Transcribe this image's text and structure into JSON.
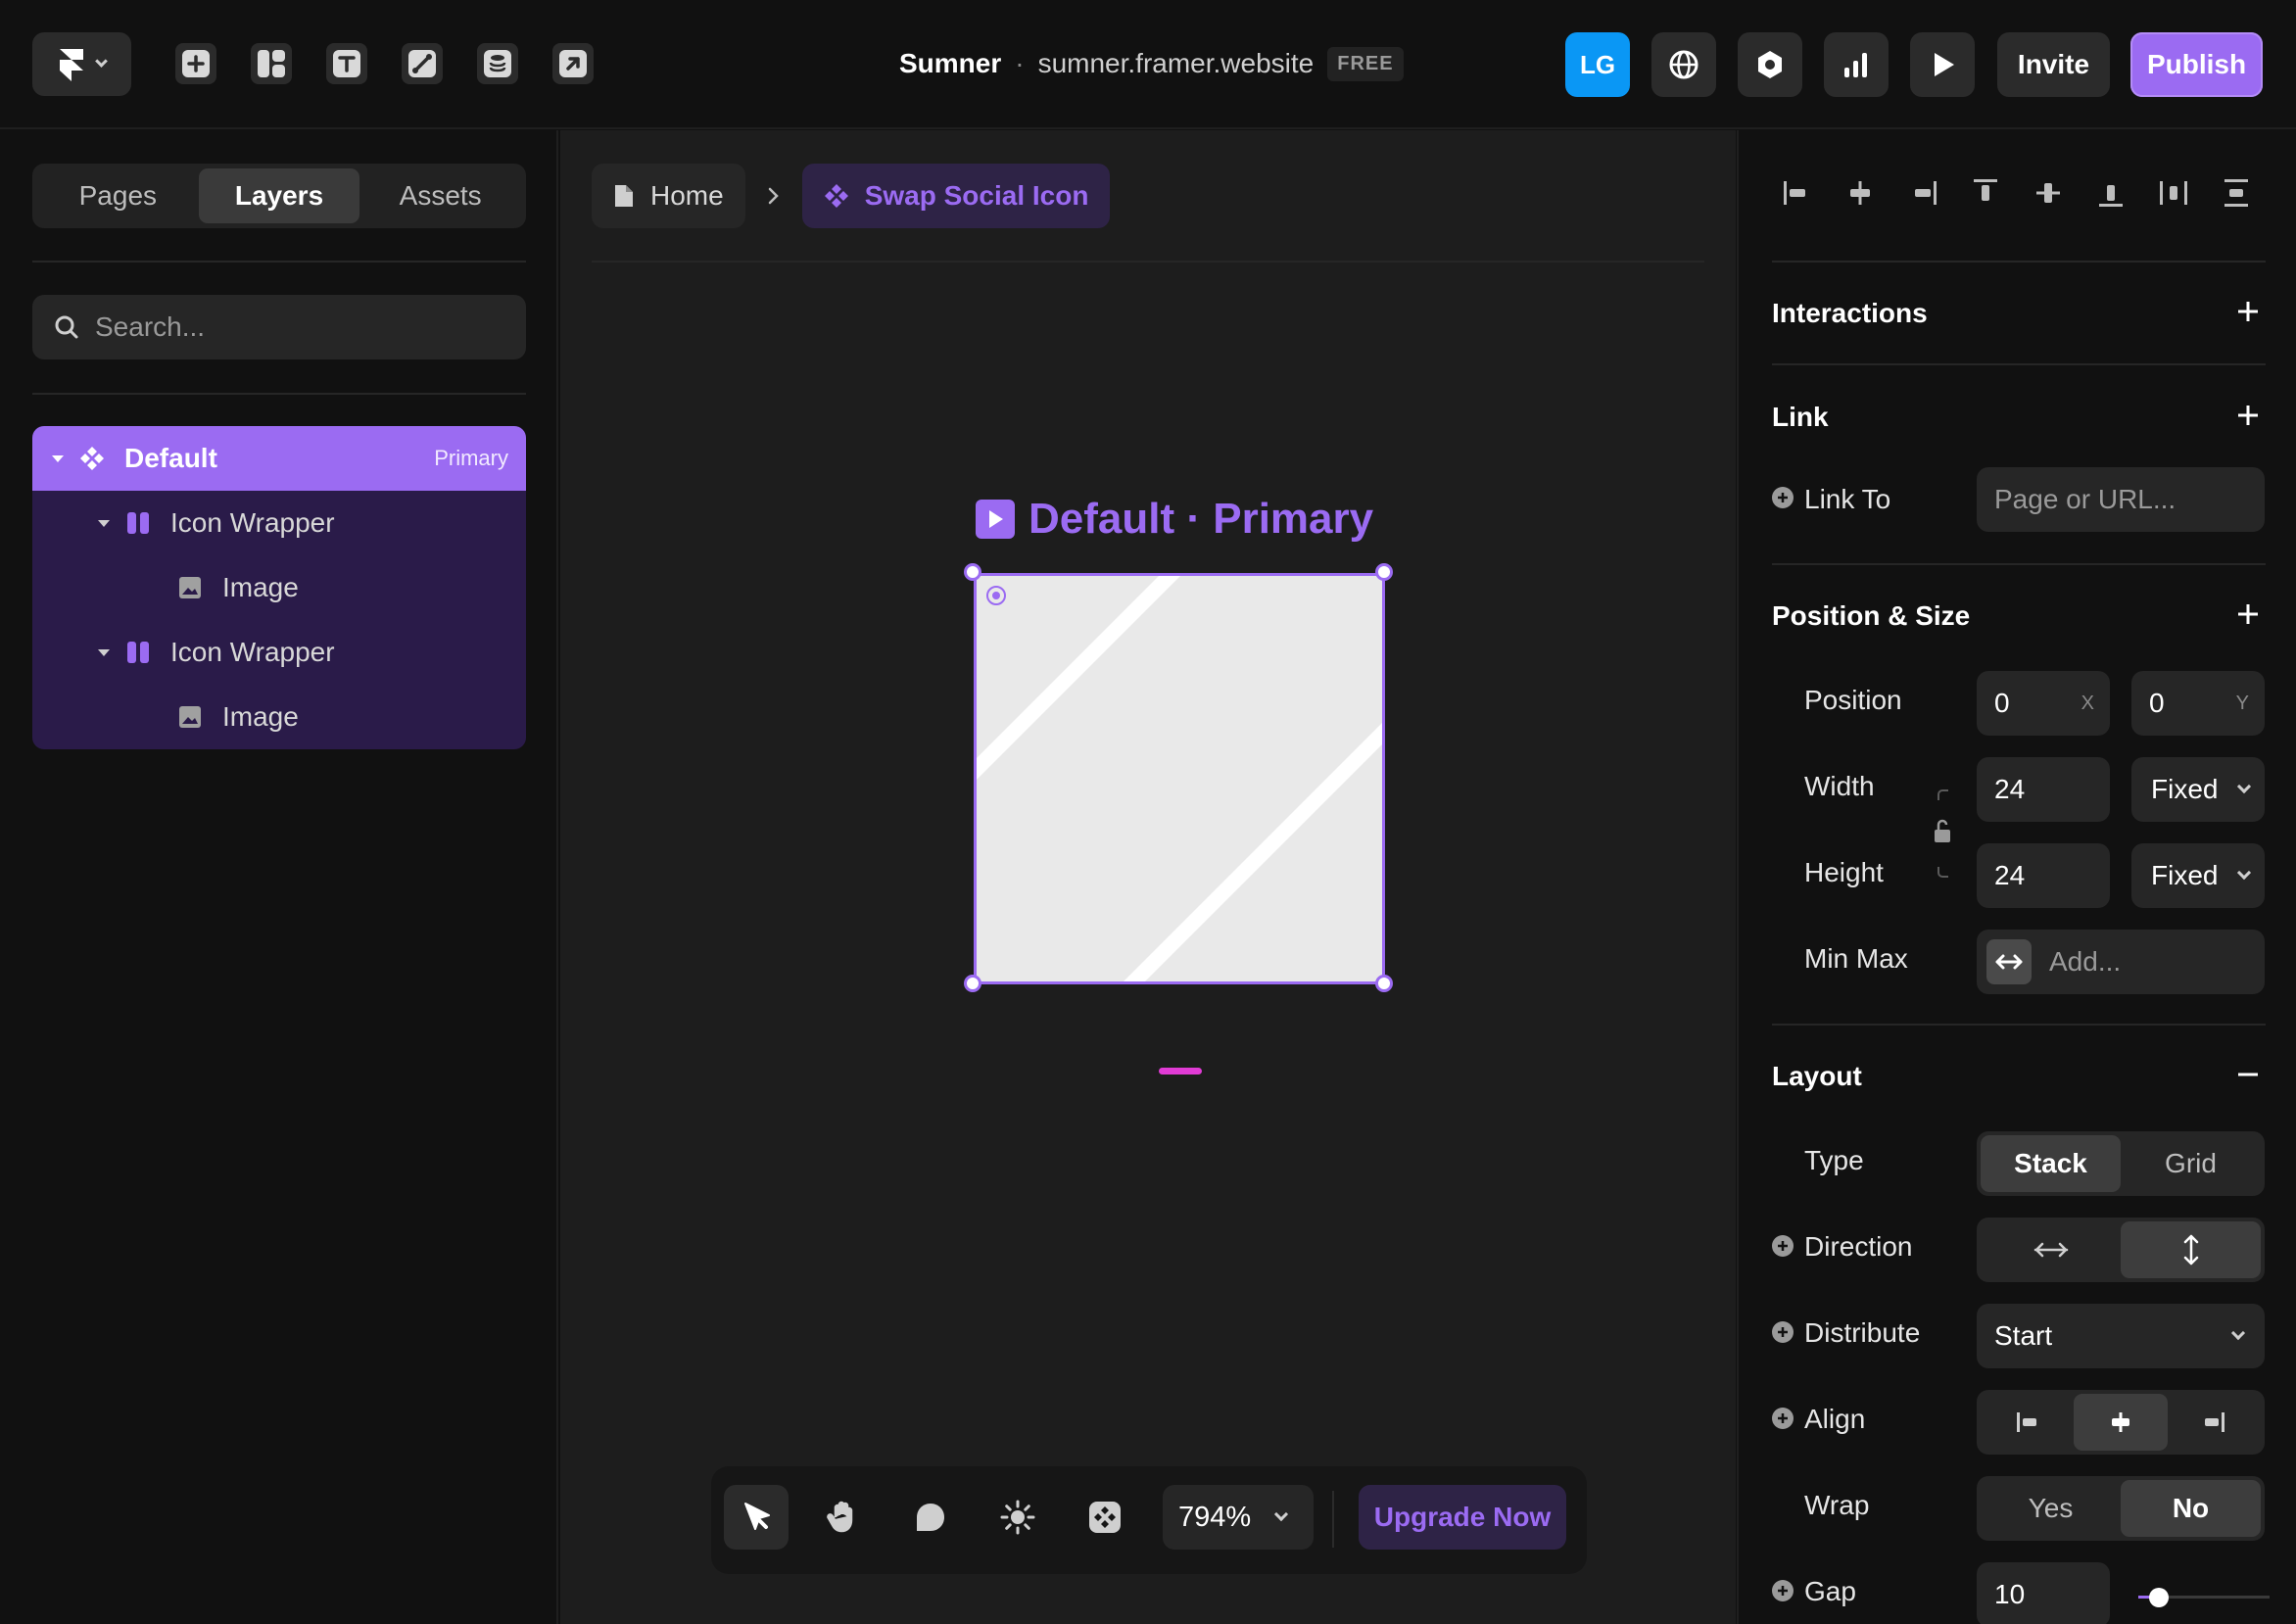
{
  "topbar": {
    "site_name": "Sumner",
    "separator": "·",
    "site_domain": "sumner.framer.website",
    "plan_badge": "FREE",
    "avatar_initials": "LG",
    "invite_label": "Invite",
    "publish_label": "Publish",
    "tools": [
      "insert-icon",
      "layout-icon",
      "text-icon",
      "vector-pen-icon",
      "cms-database-icon",
      "external-link-icon"
    ],
    "right_icons": [
      "globe-icon",
      "settings-icon",
      "analytics-icon",
      "preview-play-icon"
    ]
  },
  "left_panel": {
    "tabs": [
      {
        "label": "Pages",
        "active": false
      },
      {
        "label": "Layers",
        "active": true
      },
      {
        "label": "Assets",
        "active": false
      }
    ],
    "search_placeholder": "Search...",
    "layers": [
      {
        "label": "Default",
        "badge": "Primary",
        "depth": 0,
        "type": "component",
        "selected": true,
        "expanded": true
      },
      {
        "label": "Icon Wrapper",
        "depth": 1,
        "type": "stack",
        "expanded": true
      },
      {
        "label": "Image",
        "depth": 2,
        "type": "image"
      },
      {
        "label": "Icon Wrapper",
        "depth": 1,
        "type": "stack",
        "expanded": true
      },
      {
        "label": "Image",
        "depth": 2,
        "type": "image"
      }
    ]
  },
  "canvas": {
    "breadcrumb": [
      {
        "label": "Home",
        "icon": "page-icon"
      },
      {
        "label": "Swap Social Icon",
        "icon": "component-icon",
        "active": true
      }
    ],
    "frame_label": "Default · Primary",
    "zoom": "794%",
    "upgrade_label": "Upgrade Now",
    "tools": [
      "select-pointer-icon",
      "hand-pan-icon",
      "comment-icon",
      "theme-sun-icon",
      "components-icon"
    ]
  },
  "right_panel": {
    "alignment_icons": [
      "align-left-icon",
      "align-center-h-icon",
      "align-right-icon",
      "align-top-icon",
      "align-middle-v-icon",
      "align-bottom-icon",
      "distribute-h-icon",
      "distribute-v-icon"
    ],
    "interactions": {
      "title": "Interactions"
    },
    "link": {
      "title": "Link",
      "link_to_label": "Link To",
      "link_to_placeholder": "Page or URL..."
    },
    "position_size": {
      "title": "Position & Size",
      "position_label": "Position",
      "position_x": "0",
      "position_y": "0",
      "x_axis": "X",
      "y_axis": "Y",
      "width_label": "Width",
      "width_value": "24",
      "width_mode": "Fixed",
      "height_label": "Height",
      "height_value": "24",
      "height_mode": "Fixed",
      "minmax_label": "Min Max",
      "minmax_placeholder": "Add..."
    },
    "layout": {
      "title": "Layout",
      "type_label": "Type",
      "type_options": [
        {
          "label": "Stack",
          "on": true
        },
        {
          "label": "Grid",
          "on": false
        }
      ],
      "direction_label": "Direction",
      "direction_selected": "vertical",
      "distribute_label": "Distribute",
      "distribute_value": "Start",
      "align_label": "Align",
      "align_selected": "center",
      "wrap_label": "Wrap",
      "wrap_options": [
        {
          "label": "Yes",
          "on": false
        },
        {
          "label": "No",
          "on": true
        }
      ],
      "gap_label": "Gap",
      "gap_value": "10",
      "gap_slider_fraction": 0.1
    }
  },
  "colors": {
    "accent": "#9b6bf2",
    "avatar_blue": "#0a97f5",
    "background": "#111111",
    "canvas": "#1d1d1d",
    "panel_field": "#262626",
    "layer_tree_bg": "#2a1b49"
  }
}
